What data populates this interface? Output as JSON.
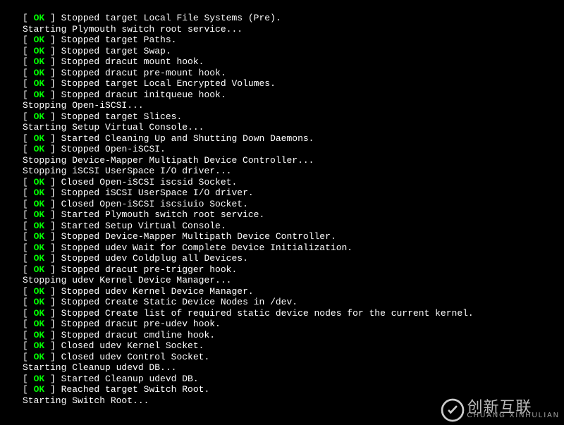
{
  "status_label": "OK",
  "brackets": {
    "open": "[  ",
    "close": "  ] "
  },
  "indent_pad": "         ",
  "lines": [
    {
      "status": true,
      "text": "Stopped target Local File Systems (Pre)."
    },
    {
      "status": false,
      "text": "Starting Plymouth switch root service..."
    },
    {
      "status": true,
      "text": "Stopped target Paths."
    },
    {
      "status": true,
      "text": "Stopped target Swap."
    },
    {
      "status": true,
      "text": "Stopped dracut mount hook."
    },
    {
      "status": true,
      "text": "Stopped dracut pre-mount hook."
    },
    {
      "status": true,
      "text": "Stopped target Local Encrypted Volumes."
    },
    {
      "status": true,
      "text": "Stopped dracut initqueue hook."
    },
    {
      "status": false,
      "text": "Stopping Open-iSCSI..."
    },
    {
      "status": true,
      "text": "Stopped target Slices."
    },
    {
      "status": false,
      "text": "Starting Setup Virtual Console..."
    },
    {
      "status": true,
      "text": "Started Cleaning Up and Shutting Down Daemons."
    },
    {
      "status": true,
      "text": "Stopped Open-iSCSI."
    },
    {
      "status": false,
      "text": "Stopping Device-Mapper Multipath Device Controller..."
    },
    {
      "status": false,
      "text": "Stopping iSCSI UserSpace I/O driver..."
    },
    {
      "status": true,
      "text": "Closed Open-iSCSI iscsid Socket."
    },
    {
      "status": true,
      "text": "Stopped iSCSI UserSpace I/O driver."
    },
    {
      "status": true,
      "text": "Closed Open-iSCSI iscsiuio Socket."
    },
    {
      "status": true,
      "text": "Started Plymouth switch root service."
    },
    {
      "status": true,
      "text": "Started Setup Virtual Console."
    },
    {
      "status": true,
      "text": "Stopped Device-Mapper Multipath Device Controller."
    },
    {
      "status": true,
      "text": "Stopped udev Wait for Complete Device Initialization."
    },
    {
      "status": true,
      "text": "Stopped udev Coldplug all Devices."
    },
    {
      "status": true,
      "text": "Stopped dracut pre-trigger hook."
    },
    {
      "status": false,
      "text": "Stopping udev Kernel Device Manager..."
    },
    {
      "status": true,
      "text": "Stopped udev Kernel Device Manager."
    },
    {
      "status": true,
      "text": "Stopped Create Static Device Nodes in /dev."
    },
    {
      "status": true,
      "text": "Stopped Create list of required static device nodes for the current kernel."
    },
    {
      "status": true,
      "text": "Stopped dracut pre-udev hook."
    },
    {
      "status": true,
      "text": "Stopped dracut cmdline hook."
    },
    {
      "status": true,
      "text": "Closed udev Kernel Socket."
    },
    {
      "status": true,
      "text": "Closed udev Control Socket."
    },
    {
      "status": false,
      "text": "Starting Cleanup udevd DB..."
    },
    {
      "status": true,
      "text": "Started Cleanup udevd DB."
    },
    {
      "status": true,
      "text": "Reached target Switch Root."
    },
    {
      "status": false,
      "text": "Starting Switch Root..."
    }
  ],
  "watermark": {
    "main": "创新互联",
    "sub": "CHUANG XINHULIAN"
  }
}
